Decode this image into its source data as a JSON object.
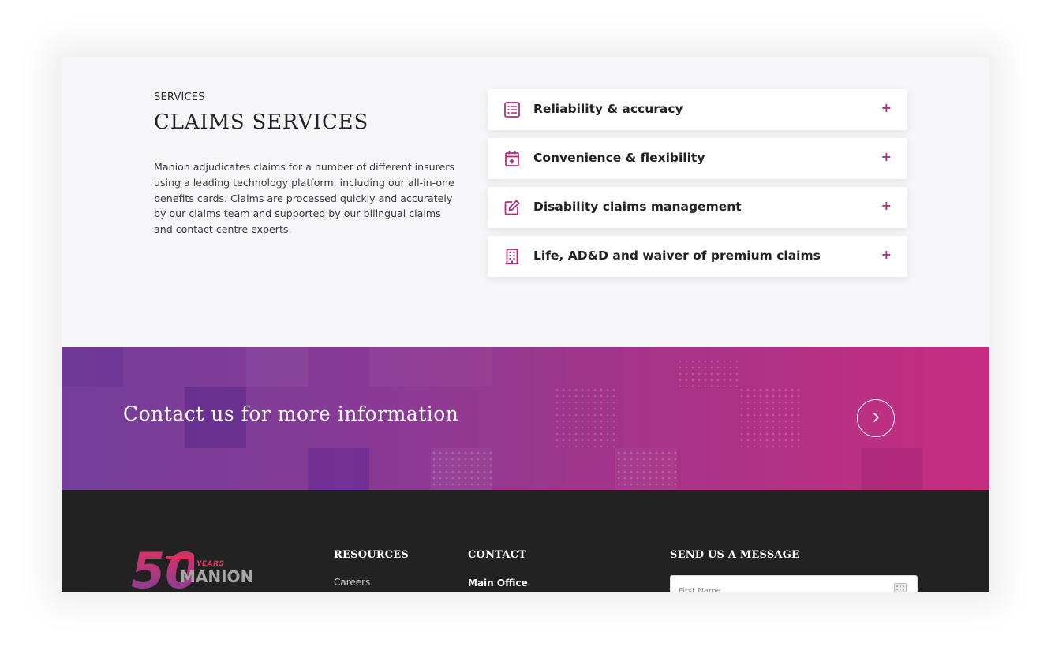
{
  "services": {
    "eyebrow": "SERVICES",
    "title": "CLAIMS SERVICES",
    "description": "Manion adjudicates claims for a number of different insurers using a leading technology platform, including our all-in-one benefits cards. Claims are processed quickly and accurately by our claims team and supported by our bilingual claims and contact centre experts.",
    "accordion": [
      {
        "label": "Reliability & accuracy",
        "icon": "list-icon",
        "toggle": "+"
      },
      {
        "label": "Convenience & flexibility",
        "icon": "calendar-plus-icon",
        "toggle": "+"
      },
      {
        "label": "Disability claims management",
        "icon": "edit-icon",
        "toggle": "+"
      },
      {
        "label": "Life, AD&D and waiver of premium claims",
        "icon": "building-icon",
        "toggle": "+"
      }
    ]
  },
  "cta": {
    "text": "Contact us for more information",
    "button_icon": "chevron-right-icon"
  },
  "footer": {
    "logo": {
      "number": "50",
      "years": "YEARS",
      "name": "MANION"
    },
    "resources": {
      "heading": "RESOURCES",
      "links": [
        "Careers"
      ]
    },
    "contact": {
      "heading": "CONTACT",
      "office_label": "Main Office"
    },
    "message": {
      "heading": "SEND US A MESSAGE",
      "first_name_placeholder": "First Name"
    }
  },
  "colors": {
    "accent": "#b8287e",
    "banner_start": "#733e9a",
    "banner_end": "#c72d80",
    "footer_bg": "#222222",
    "section_bg": "#f6f6f8"
  }
}
